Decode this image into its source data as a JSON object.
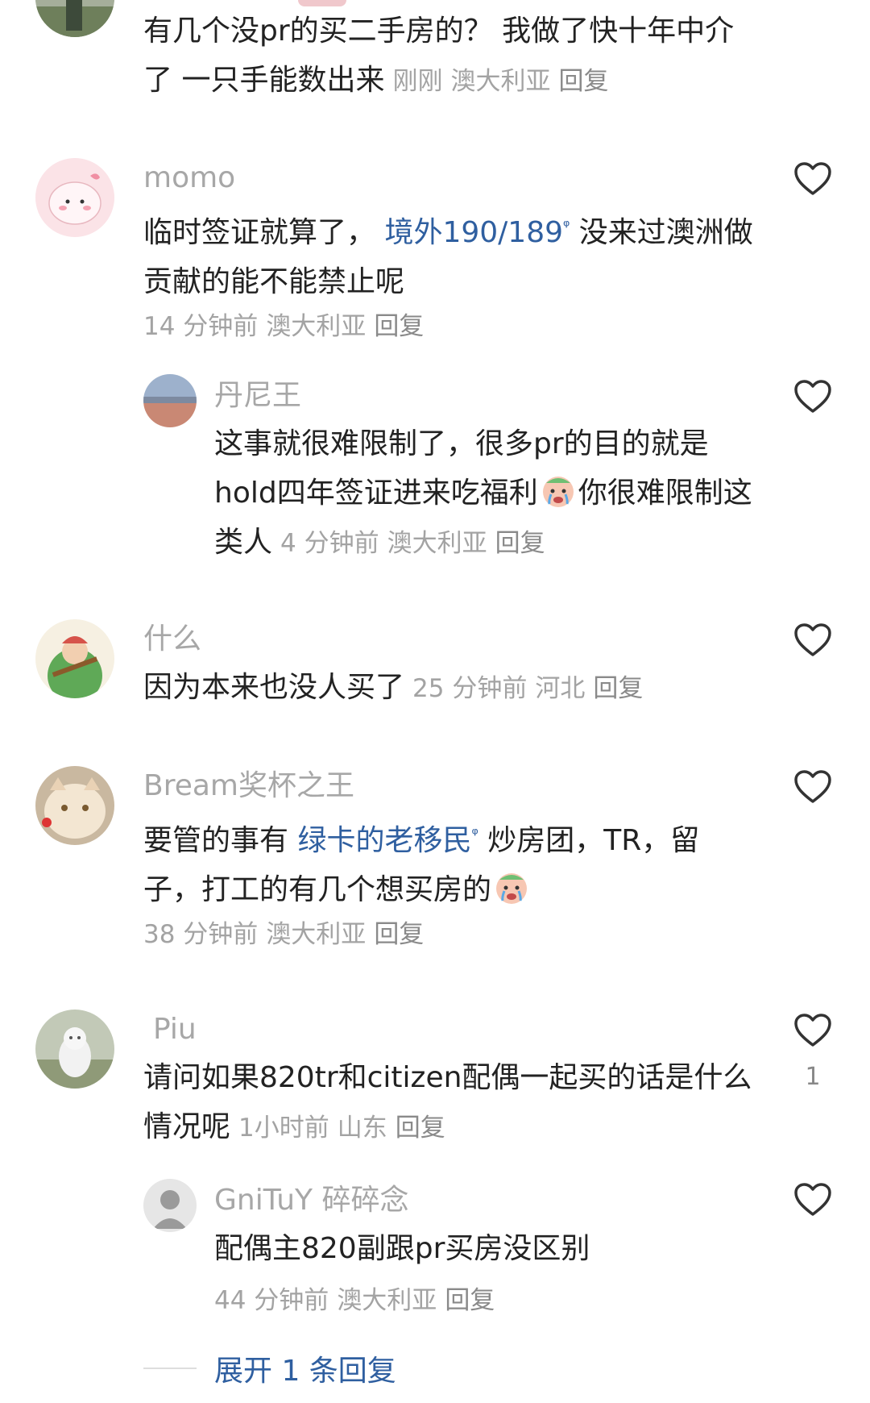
{
  "comments": [
    {
      "user": "",
      "text": "有几个没pr的买二手房的？ 我做了快十年中介了 一只手能数出来",
      "meta": {
        "time": "刚刚",
        "location": "澳大利亚",
        "reply": "回复"
      }
    },
    {
      "user": "momo",
      "text_a": "临时签证就算了，",
      "tag": "境外190/189",
      "text_b": "没来过澳洲做贡献的能不能禁止呢",
      "meta": {
        "time": "14 分钟前",
        "location": "澳大利亚",
        "reply": "回复"
      }
    },
    {
      "user": "丹尼王",
      "text_a": "这事就很难限制了，很多pr的目的就是hold四年签证进来吃福利",
      "text_b": "你很难限制这类人",
      "meta": {
        "time": "4 分钟前",
        "location": "澳大利亚",
        "reply": "回复"
      }
    },
    {
      "user": "什么",
      "text": "因为本来也没人买了",
      "meta": {
        "time": "25 分钟前",
        "location": "河北",
        "reply": "回复"
      }
    },
    {
      "user": "Bream奖杯之王",
      "text_a": "要管的事有",
      "tag": "绿卡的老移民",
      "text_b": "炒房团，TR，留子，打工的有几个想买房的",
      "meta": {
        "time": "38 分钟前",
        "location": "澳大利亚",
        "reply": "回复"
      }
    },
    {
      "user": "Piu",
      "text": "请问如果820tr和citizen配偶一起买的话是什么情况呢",
      "like_count": "1",
      "meta": {
        "time": "1小时前",
        "location": "山东",
        "reply": "回复"
      }
    },
    {
      "user": "GniTuY 碎碎念",
      "text": "配偶主820副跟pr买房没区别",
      "meta": {
        "time": "44 分钟前",
        "location": "澳大利亚",
        "reply": "回复"
      }
    }
  ],
  "expand_label": "展开 1 条回复",
  "tag_marker": "ᵠ",
  "icons": {
    "like": "heart-outline-icon",
    "emoji": "crying-face-emoji"
  },
  "colors": {
    "tag": "#2f5fa0",
    "meta": "#a3a3a3"
  }
}
